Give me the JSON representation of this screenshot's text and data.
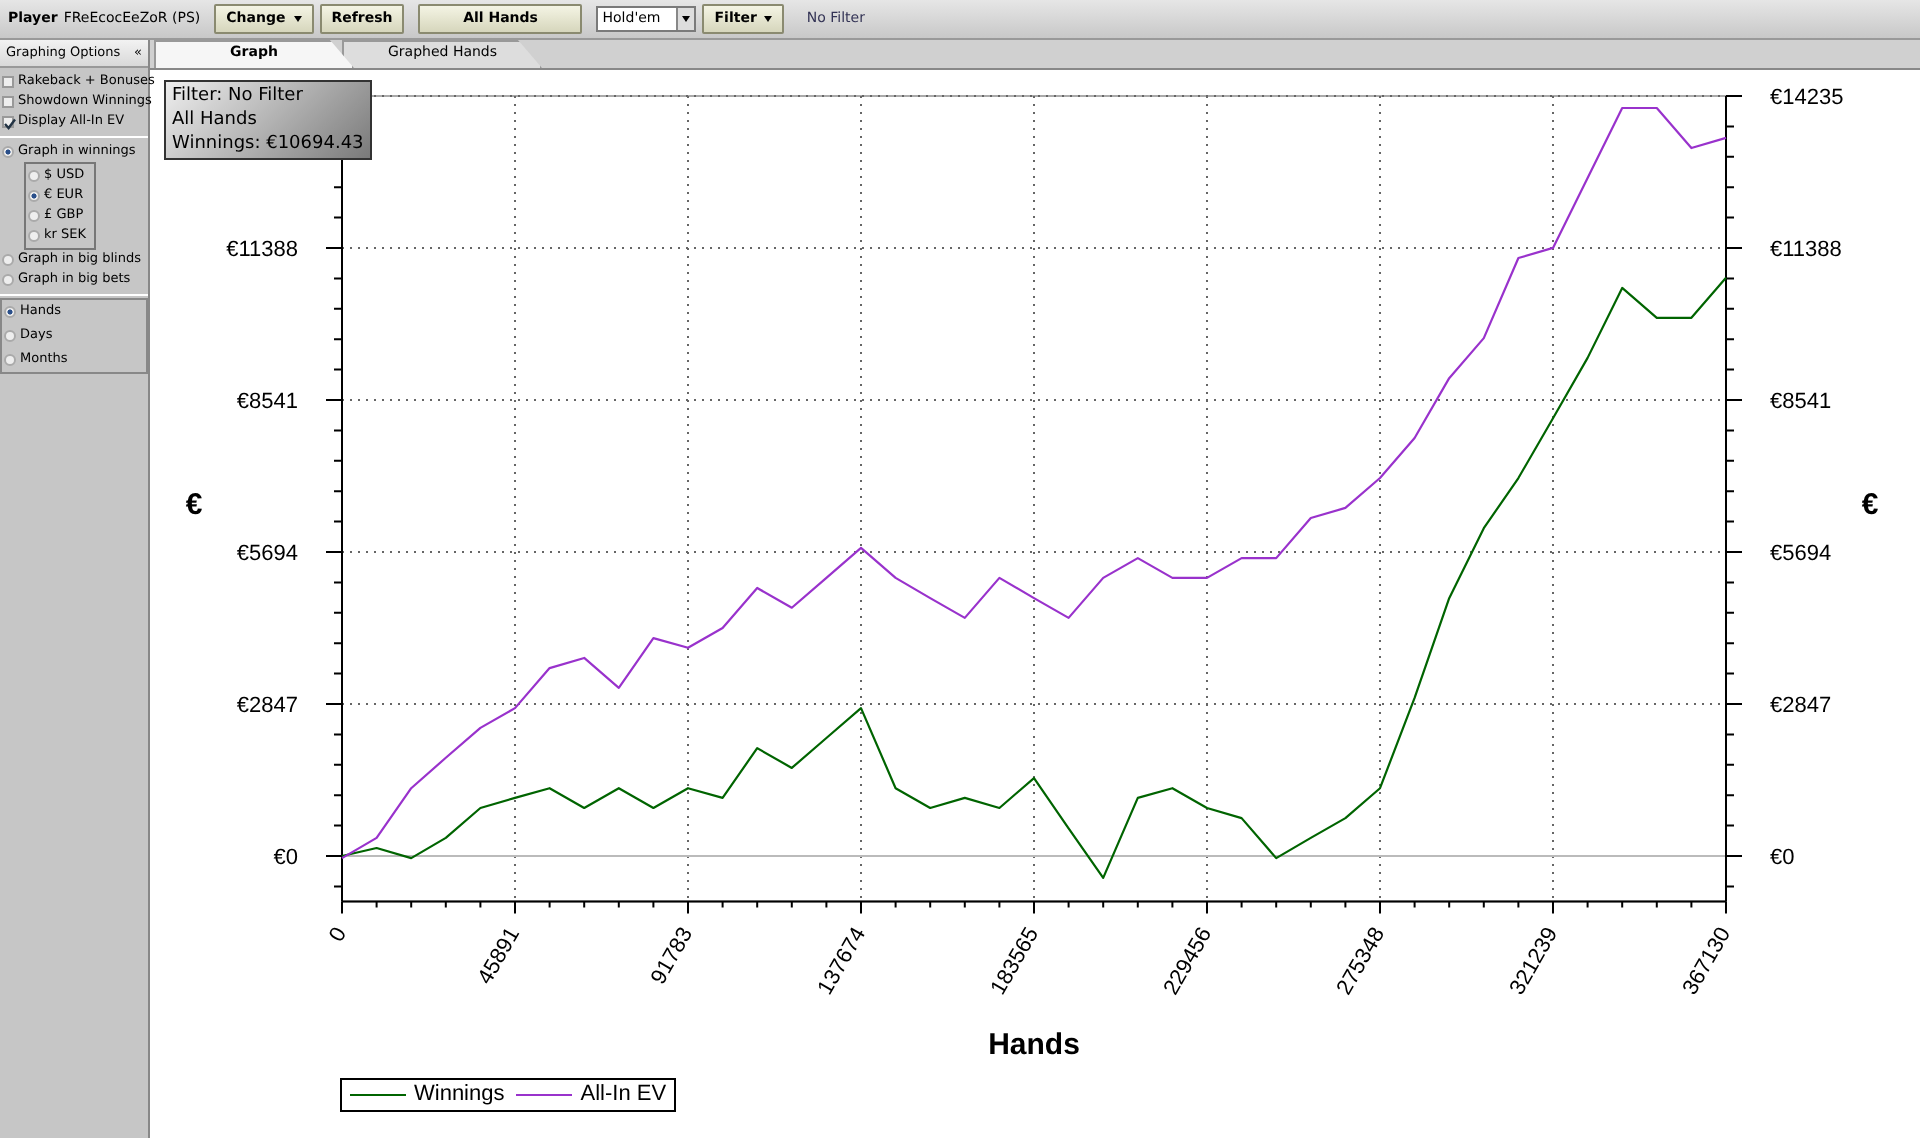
{
  "toolbar": {
    "player_label": "Player",
    "player_name": "FReEcocEeZoR (PS)",
    "buttons": [
      {
        "label": "Change",
        "dropdown": true
      },
      {
        "label": "Refresh",
        "dropdown": false
      },
      {
        "label": "All Hands",
        "dropdown": false,
        "wide": true
      }
    ],
    "game_select": {
      "value": "Hold'em"
    },
    "filter_button": {
      "label": "Filter",
      "dropdown": true
    },
    "filter_status": "No Filter"
  },
  "sidebar": {
    "title": "Graphing Options",
    "collapse": "«",
    "checkboxes": [
      {
        "label": "Rakeback + Bonuses",
        "checked": false
      },
      {
        "label": "Showdown Winnings",
        "checked": false
      },
      {
        "label": "Display All-In EV",
        "checked": true
      }
    ],
    "graph_modes": [
      {
        "label": "Graph in winnings",
        "selected": true,
        "currencies": [
          {
            "label": "$ USD",
            "selected": false
          },
          {
            "label": "€ EUR",
            "selected": true
          },
          {
            "label": "£ GBP",
            "selected": false
          },
          {
            "label": "kr SEK",
            "selected": false
          }
        ]
      },
      {
        "label": "Graph in big blinds",
        "selected": false
      },
      {
        "label": "Graph in big bets",
        "selected": false
      }
    ],
    "periods": [
      {
        "label": "Hands",
        "selected": true
      },
      {
        "label": "Days",
        "selected": false
      },
      {
        "label": "Months",
        "selected": false
      }
    ]
  },
  "tabs": [
    {
      "label": "Graph",
      "selected": true
    },
    {
      "label": "Graphed Hands",
      "selected": false
    }
  ],
  "info_box": [
    "Filter: No Filter",
    "All Hands",
    "Winnings: €10694.43"
  ],
  "chart_data": {
    "type": "line",
    "grid": true,
    "xlabel": "Hands",
    "ylabel": "€",
    "xlim": [
      0,
      367130
    ],
    "ylim": [
      -850,
      14235
    ],
    "xticks": [
      0,
      45891,
      91783,
      137674,
      183565,
      229456,
      275348,
      321239,
      367130
    ],
    "yticks": [
      {
        "value": 0,
        "label": "€0"
      },
      {
        "value": 2847,
        "label": "€2847"
      },
      {
        "value": 5694,
        "label": "€5694"
      },
      {
        "value": 8541,
        "label": "€8541"
      },
      {
        "value": 11388,
        "label": "€11388"
      },
      {
        "value": 14235,
        "label": "€14235"
      }
    ],
    "x": [
      0,
      9178,
      18357,
      27535,
      36713,
      45891,
      55070,
      64248,
      73426,
      82604,
      91783,
      100961,
      110139,
      119318,
      128496,
      137674,
      146852,
      156031,
      165209,
      174387,
      183565,
      192744,
      201922,
      211100,
      220278,
      229456,
      238635,
      247813,
      256991,
      266169,
      275348,
      284526,
      293704,
      302882,
      312061,
      321239,
      330417,
      339596,
      348774,
      357952,
      367130
    ],
    "series": [
      {
        "name": "Winnings",
        "color": "#006400",
        "values": [
          0,
          150,
          -40,
          340,
          900,
          1090,
          1270,
          900,
          1270,
          900,
          1270,
          1090,
          2020,
          1650,
          2210,
          2770,
          1270,
          900,
          1090,
          900,
          1460,
          520,
          -410,
          1090,
          1270,
          900,
          710,
          -40,
          340,
          710,
          1270,
          2960,
          4830,
          6140,
          7080,
          8200,
          9330,
          10640,
          10080,
          10080,
          10830
        ]
      },
      {
        "name": "All-In EV",
        "color": "#9932cc",
        "values": [
          -40,
          340,
          1270,
          1840,
          2400,
          2770,
          3520,
          3710,
          3150,
          4080,
          3900,
          4270,
          5020,
          4650,
          5210,
          5770,
          5210,
          4830,
          4460,
          5210,
          4830,
          4460,
          5210,
          5580,
          5210,
          5210,
          5580,
          5580,
          6330,
          6520,
          7080,
          7830,
          8950,
          9700,
          11200,
          11390,
          12700,
          14010,
          14010,
          13260,
          13450
        ]
      }
    ]
  }
}
